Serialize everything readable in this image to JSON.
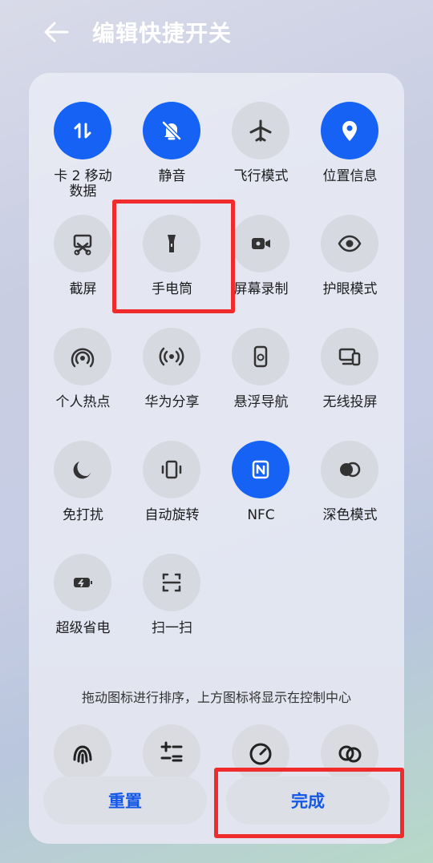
{
  "header": {
    "title": "编辑快捷开关"
  },
  "tiles": [
    {
      "label": "卡 2 移动\n数据",
      "icon": "mobile-data-icon",
      "on": true
    },
    {
      "label": "静音",
      "icon": "bell-off-icon",
      "on": true
    },
    {
      "label": "飞行模式",
      "icon": "airplane-icon",
      "on": false
    },
    {
      "label": "位置信息",
      "icon": "location-pin-icon",
      "on": true
    },
    {
      "label": "截屏",
      "icon": "screenshot-scissors-icon",
      "on": false
    },
    {
      "label": "手电筒",
      "icon": "flashlight-icon",
      "on": false
    },
    {
      "label": "屏幕录制",
      "icon": "screen-record-icon",
      "on": false
    },
    {
      "label": "护眼模式",
      "icon": "eye-icon",
      "on": false
    },
    {
      "label": "个人热点",
      "icon": "hotspot-icon",
      "on": false
    },
    {
      "label": "华为分享",
      "icon": "huawei-share-icon",
      "on": false
    },
    {
      "label": "悬浮导航",
      "icon": "floating-nav-icon",
      "on": false
    },
    {
      "label": "无线投屏",
      "icon": "wireless-projection-icon",
      "on": false
    },
    {
      "label": "免打扰",
      "icon": "moon-icon",
      "on": false
    },
    {
      "label": "自动旋转",
      "icon": "auto-rotate-icon",
      "on": false
    },
    {
      "label": "NFC",
      "icon": "nfc-icon",
      "on": true
    },
    {
      "label": "深色模式",
      "icon": "dark-mode-icon",
      "on": false
    },
    {
      "label": "超级省电",
      "icon": "power-saving-icon",
      "on": false
    },
    {
      "label": "扫一扫",
      "icon": "scan-icon",
      "on": false
    }
  ],
  "hint": "拖动图标进行排序，上方图标将显示在控制中心",
  "buttons": {
    "reset": "重置",
    "done": "完成"
  },
  "colors": {
    "accent": "#1662f5",
    "highlight": "#ef2b2b"
  }
}
